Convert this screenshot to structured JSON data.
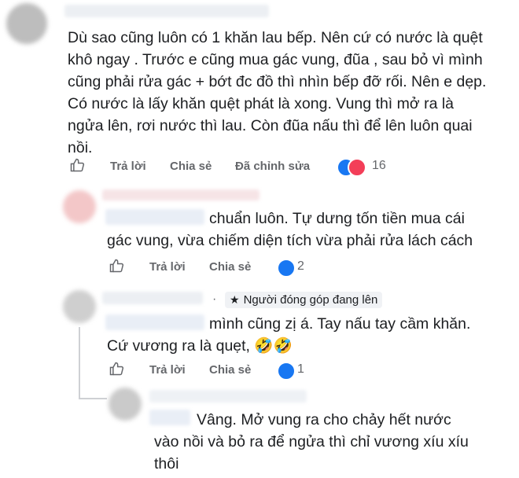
{
  "comment1": {
    "text": "Dù sao cũng luôn có 1 khăn lau bếp. Nên cứ có nước là quệt khô ngay . Trước e cũng mua gác vung, đũa , sau bỏ vì mình cũng phải rửa gác + bớt đc đồ thì nhìn bếp đỡ rối. Nên e dẹp. Có nước là lấy khăn quệt phát là xong. Vung thì mở ra là ngửa lên, rơi nước thì lau. Còn đũa nấu thì để lên luôn quai nồi.",
    "reply": "Trả lời",
    "share": "Chia sẻ",
    "edited": "Đã chỉnh sửa",
    "reaction_count": "16"
  },
  "comment2": {
    "text": "chuẩn luôn. Tự dưng tốn tiền mua cái gác vung, vừa chiếm diện tích vừa phải rửa lách cách",
    "reply": "Trả lời",
    "share": "Chia sẻ",
    "reaction_count": "2"
  },
  "comment3": {
    "dot": "·",
    "badge": "Người đóng góp đang lên",
    "text": "mình cũng zị á. Tay nấu tay cầm khăn. Cứ vương ra là quẹt,",
    "emojis": "🤣🤣",
    "reply": "Trả lời",
    "share": "Chia sẻ",
    "reaction_count": "1"
  },
  "comment4": {
    "text": "Vâng. Mở vung ra cho chảy hết nước vào nồi và bỏ ra để ngửa thì chỉ vương xíu xíu thôi"
  },
  "colors": {
    "like_blue": "#1877f2",
    "heart_red": "#f33e58",
    "action_gray": "#65676b"
  }
}
